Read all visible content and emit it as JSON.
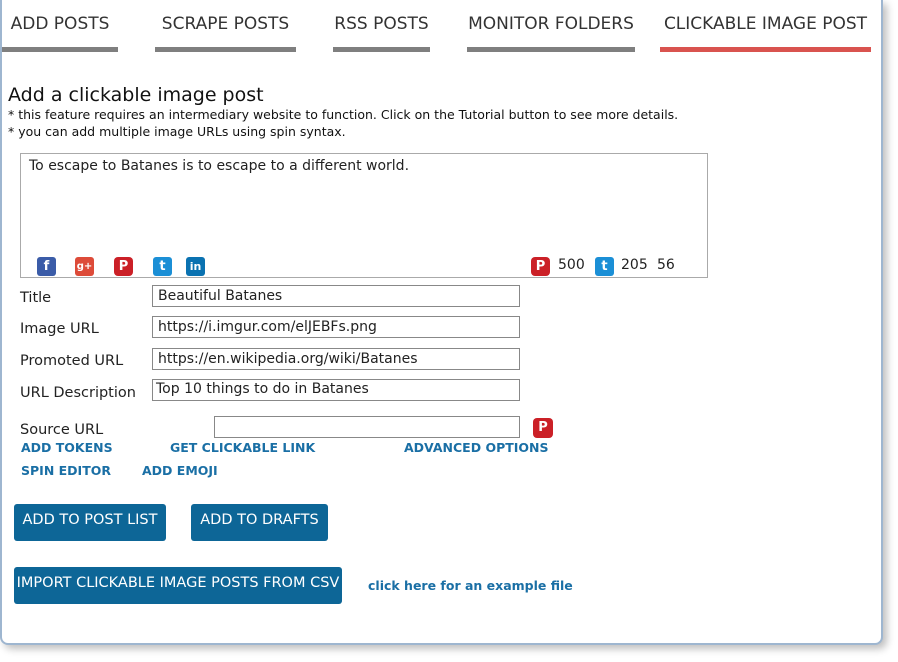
{
  "tabs": [
    {
      "label": "ADD POSTS"
    },
    {
      "label": "SCRAPE POSTS"
    },
    {
      "label": "RSS POSTS"
    },
    {
      "label": "MONITOR FOLDERS"
    },
    {
      "label": "CLICKABLE IMAGE POST",
      "active": true
    }
  ],
  "heading": "Add a clickable image post",
  "notes": [
    "* this feature requires an intermediary website to function. Click on the Tutorial button to see more details.",
    "* you can add multiple image URLs using spin syntax."
  ],
  "editor": {
    "text": "To escape to Batanes is to escape to a different world.",
    "icons": [
      "facebook-icon",
      "google-plus-icon",
      "pinterest-icon",
      "twitter-icon",
      "linkedin-icon"
    ],
    "pinterest_count": "500",
    "twitter_count": "205",
    "char_count": "56"
  },
  "fields": {
    "title": {
      "label": "Title",
      "value": "Beautiful Batanes"
    },
    "image_url": {
      "label": "Image URL",
      "value": "https://i.imgur.com/elJEBFs.png"
    },
    "promoted_url": {
      "label": "Promoted URL",
      "value": "https://en.wikipedia.org/wiki/Batanes"
    },
    "url_description": {
      "label": "URL Description",
      "value": "Top 10 things to do in Batanes"
    },
    "source_url": {
      "label": "Source URL",
      "value": ""
    }
  },
  "links": {
    "add_tokens": "ADD TOKENS",
    "get_clickable_link": "GET CLICKABLE LINK",
    "advanced_options": "ADVANCED OPTIONS",
    "spin_editor": "SPIN EDITOR",
    "add_emoji": "ADD EMOJI",
    "example_file": "click here for an example file"
  },
  "buttons": {
    "add_to_post_list": "ADD TO POST LIST",
    "add_to_drafts": "ADD TO DRAFTS",
    "import_csv": "IMPORT CLICKABLE IMAGE POSTS FROM CSV"
  },
  "colors": {
    "accent": "#0d6697",
    "active_tab": "#d9534f",
    "tab_bar": "#7f7f7f",
    "link": "#1a6fa5"
  }
}
